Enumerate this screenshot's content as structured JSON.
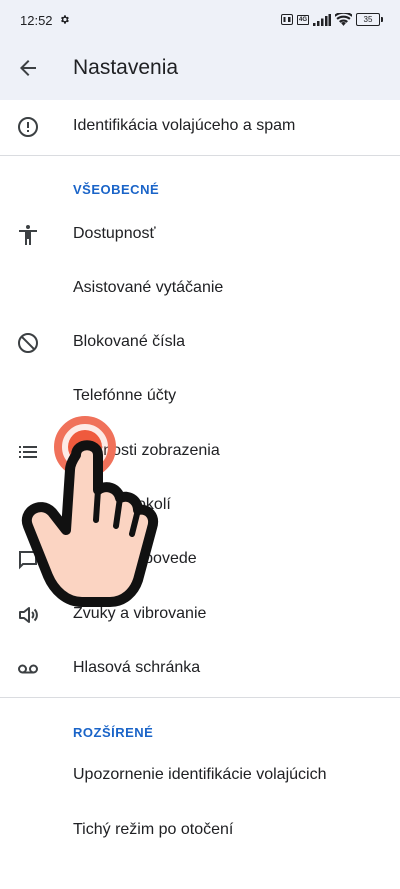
{
  "status_bar": {
    "time": "12:52",
    "network": "4G",
    "battery": "35"
  },
  "app_bar": {
    "title": "Nastavenia"
  },
  "top_item": {
    "label": "Identifikácia volajúceho a spam",
    "icon": "alert-circle-icon"
  },
  "general": {
    "header": "VŠEOBECNÉ",
    "items": [
      {
        "label": "Dostupnosť",
        "icon": "accessibility-icon"
      },
      {
        "label": "Asistované vytáčanie",
        "icon": ""
      },
      {
        "label": "Blokované čísla",
        "icon": "block-icon"
      },
      {
        "label": "Telefónne účty",
        "icon": ""
      },
      {
        "label": "Možnosti zobrazenia",
        "icon": "list-icon"
      },
      {
        "label": "Miesta v okolí",
        "icon": ""
      },
      {
        "label": "Rýchle odpovede",
        "icon": "message-icon"
      },
      {
        "label": "Zvuky a vibrovanie",
        "icon": "volume-icon"
      },
      {
        "label": "Hlasová schránka",
        "icon": "voicemail-icon"
      }
    ]
  },
  "advanced": {
    "header": "ROZŠÍRENÉ",
    "items": [
      {
        "label": "Upozornenie identifikácie volajúcich"
      },
      {
        "label": "Tichý režim po otočení"
      }
    ]
  },
  "colors": {
    "accent": "#1a64c8",
    "app_bar_bg": "#eef1f8",
    "touch_indicator": "#ef5a3d"
  }
}
